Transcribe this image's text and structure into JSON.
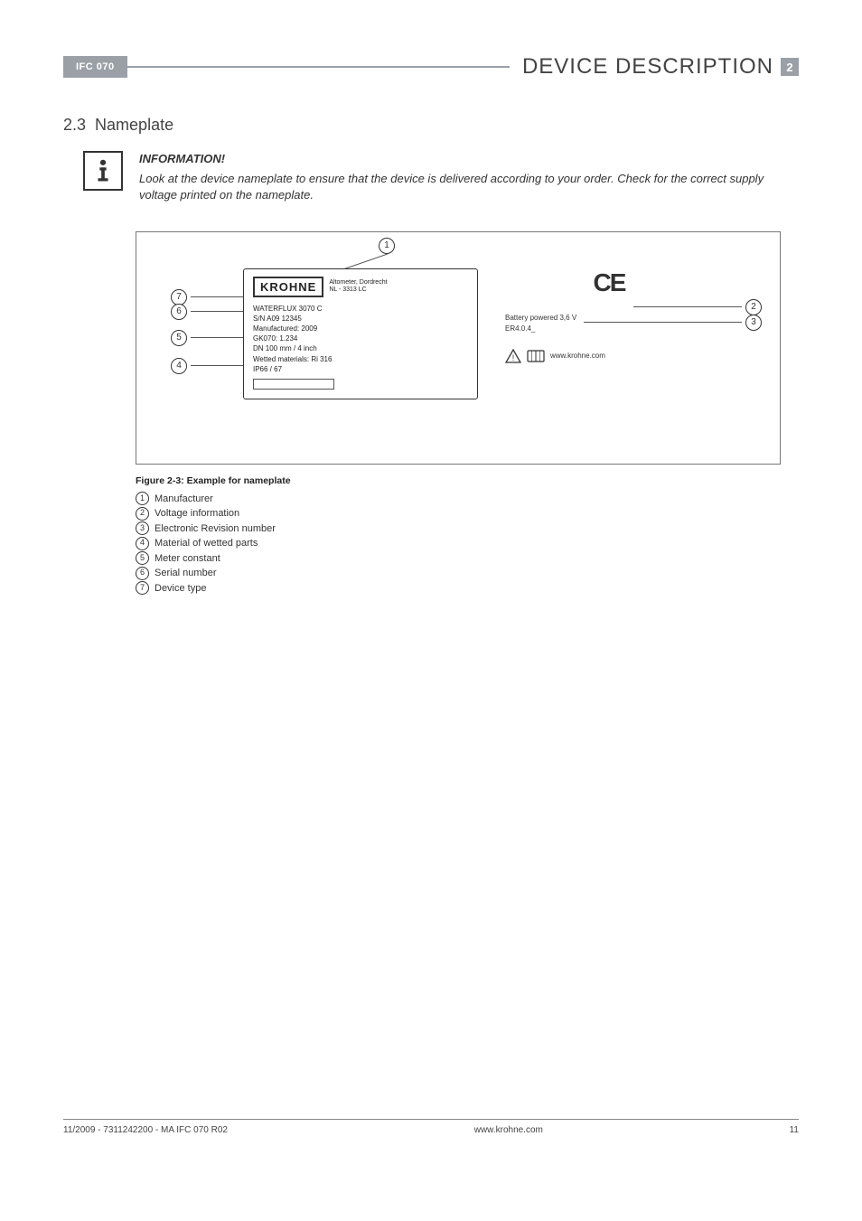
{
  "header": {
    "product": "IFC 070",
    "title": "DEVICE DESCRIPTION",
    "chapter": "2"
  },
  "section": {
    "number": "2.3",
    "title": "Nameplate"
  },
  "info": {
    "heading": "INFORMATION!",
    "body": "Look at the device nameplate to ensure that the device is delivered according to your order. Check for the correct supply voltage printed on the nameplate."
  },
  "nameplate": {
    "logo": "KROHNE",
    "sub1": "Altometer, Dordrecht",
    "sub2": "NL - 3313 LC",
    "line_device": "WATERFLUX 3070 C",
    "line_sn": "S/N A09 12345",
    "line_mfg": "Manufactured: 2009",
    "line_gk": "GK070: 1.234",
    "line_dn": "DN 100 mm / 4 inch",
    "line_wet": "Wetted materials:   Ri          316",
    "line_ip": "IP66 / 67",
    "right_power": "Battery powered 3,6 V",
    "right_er": "ER4.0.4_",
    "right_url": "www.krohne.com",
    "ce": "CE"
  },
  "figure": {
    "caption": "Figure 2-3: Example for nameplate",
    "legend": [
      {
        "n": "1",
        "t": "Manufacturer"
      },
      {
        "n": "2",
        "t": "Voltage information"
      },
      {
        "n": "3",
        "t": "Electronic Revision number"
      },
      {
        "n": "4",
        "t": "Material of wetted parts"
      },
      {
        "n": "5",
        "t": "Meter constant"
      },
      {
        "n": "6",
        "t": "Serial number"
      },
      {
        "n": "7",
        "t": "Device type"
      }
    ]
  },
  "footer": {
    "left": "11/2009 - 7311242200 - MA IFC 070 R02",
    "center": "www.krohne.com",
    "right": "11"
  },
  "callouts": {
    "c1": "1",
    "c2": "2",
    "c3": "3",
    "c4": "4",
    "c5": "5",
    "c6": "6",
    "c7": "7"
  }
}
